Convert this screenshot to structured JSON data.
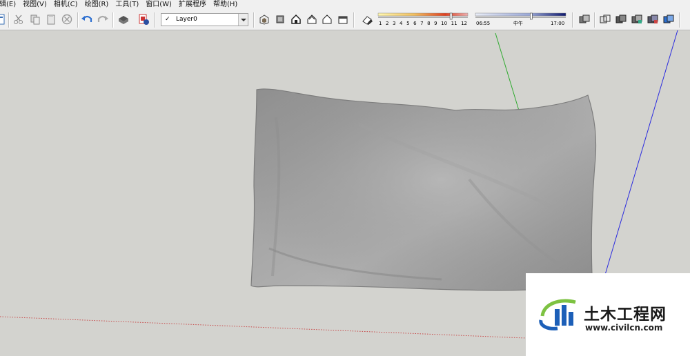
{
  "menu": {
    "items": [
      "辑(E)",
      "视图(V)",
      "相机(C)",
      "绘图(R)",
      "工具(T)",
      "窗口(W)",
      "扩展程序",
      "帮助(H)"
    ]
  },
  "toolbar": {
    "layer": {
      "selected": "Layer0",
      "check": "✓"
    },
    "shadow_months": [
      "1",
      "2",
      "3",
      "4",
      "5",
      "6",
      "7",
      "8",
      "9",
      "10",
      "11",
      "12"
    ],
    "shadow_time": {
      "start": "06:55",
      "mid": "中午",
      "end": "17:00"
    },
    "month_slider_level": 0.82,
    "time_slider_level": 0.62,
    "colors": {
      "menubar_bg": "#f0f0f0",
      "viewport_bg": "#d3d3cf",
      "axis_green": "#2eaa2e",
      "axis_blue": "#2a2adf",
      "axis_red_dotted": "#c84a4a"
    }
  },
  "scene": {
    "object": "pillow-3d-model",
    "pillow_color": "#9a9a9a"
  },
  "watermark": {
    "title": "土木工程网",
    "url": "www.civilcn.com",
    "colors": {
      "logo_blue": "#1c5fb8",
      "logo_green": "#7dc242"
    }
  }
}
